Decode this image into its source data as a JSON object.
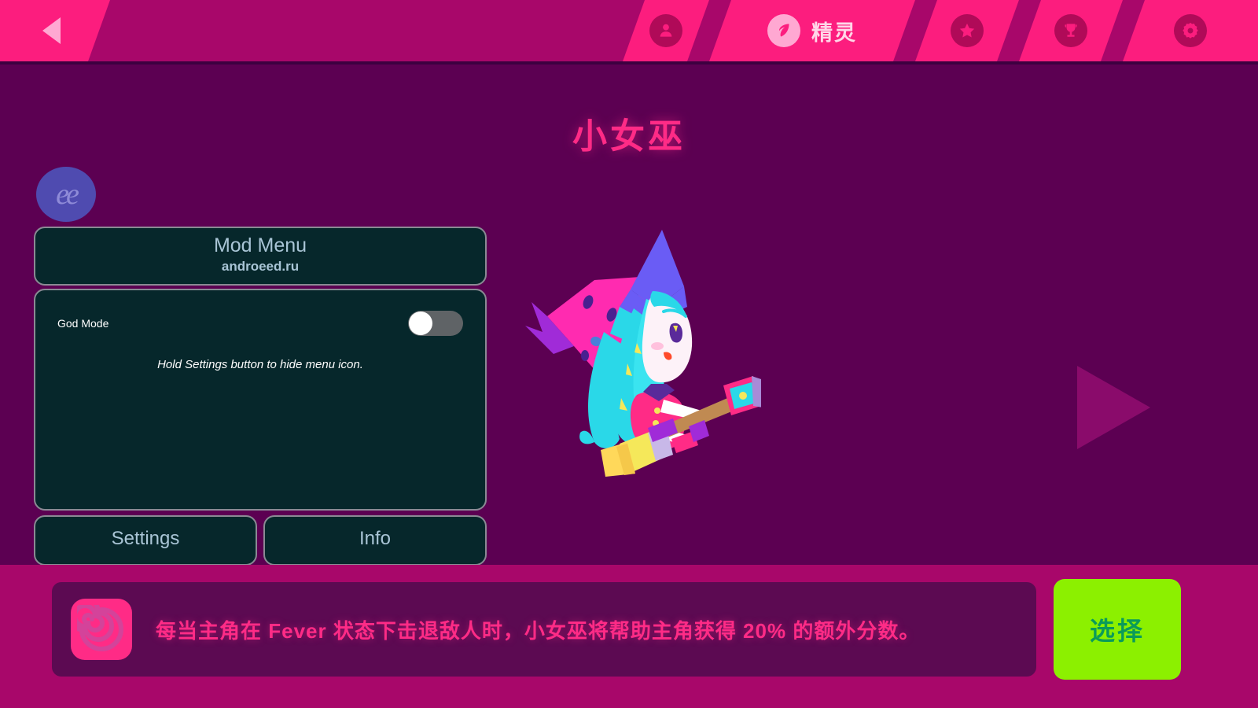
{
  "header": {
    "back_icon": "back-triangle-icon",
    "nav_items": [
      {
        "icon": "person-icon",
        "label": "",
        "active": false
      },
      {
        "icon": "leaf-icon",
        "label": "精灵",
        "active": true
      },
      {
        "icon": "star-icon",
        "label": "",
        "active": false
      },
      {
        "icon": "trophy-icon",
        "label": "",
        "active": false
      },
      {
        "icon": "gear-icon",
        "label": "",
        "active": false
      }
    ]
  },
  "main": {
    "character_title": "小女巫",
    "logo_text": "ee",
    "next_arrow_icon": "next-arrow-icon",
    "character_art_name": "little-witch-illustration"
  },
  "mod_menu": {
    "title": "Mod Menu",
    "subtitle": "androeed.ru",
    "rows": [
      {
        "label": "God Mode",
        "toggle_on": false
      }
    ],
    "hint": "Hold Settings button to hide menu icon.",
    "settings_label": "Settings",
    "info_label": "Info"
  },
  "footer": {
    "skill_icon": "spiral-icon",
    "description": "每当主角在 Fever 状态下击退敌人时，小女巫将帮助主角获得 20% 的额外分数。",
    "select_label": "选择"
  },
  "colors": {
    "header_pink": "#fc1d7e",
    "header_dark_pink": "#a8076a",
    "background_purple": "#5c0052",
    "panel_teal": "#06272b",
    "panel_border": "#8a8a94",
    "panel_text": "#a9c5d6",
    "accent_pink": "#ff2b86",
    "select_green": "#8cf000",
    "select_text_green": "#0a9b5a"
  }
}
